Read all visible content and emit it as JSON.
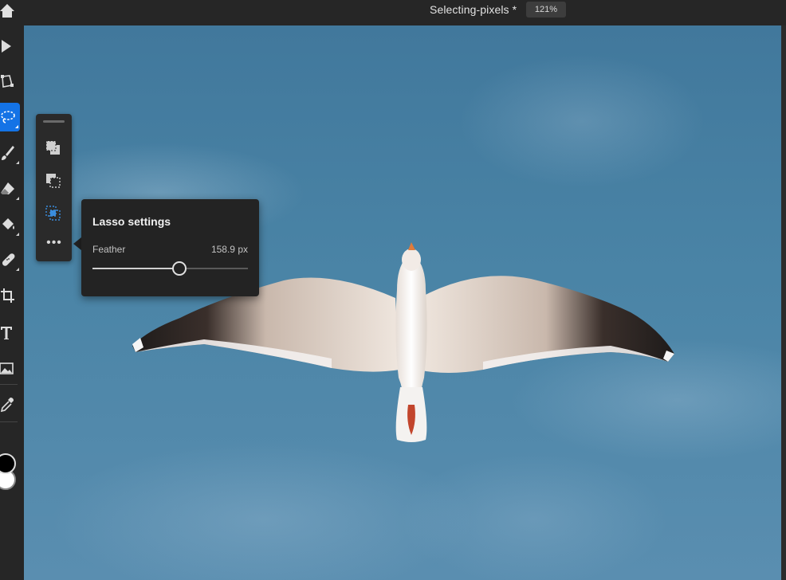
{
  "header": {
    "document_title": "Selecting-pixels *",
    "zoom_level": "121%"
  },
  "toolbar": {
    "tools": [
      {
        "name": "move-tool",
        "icon": "arrow-pointer-icon"
      },
      {
        "name": "transform-tool",
        "icon": "transform-icon"
      },
      {
        "name": "lasso-tool",
        "icon": "lasso-icon",
        "active": true
      },
      {
        "name": "brush-tool",
        "icon": "brush-icon"
      },
      {
        "name": "eraser-tool",
        "icon": "eraser-icon"
      },
      {
        "name": "fill-tool",
        "icon": "paint-bucket-icon"
      },
      {
        "name": "healing-tool",
        "icon": "bandage-icon"
      },
      {
        "name": "crop-tool",
        "icon": "crop-icon"
      },
      {
        "name": "type-tool",
        "icon": "type-icon"
      },
      {
        "name": "place-image-tool",
        "icon": "image-icon"
      },
      {
        "name": "eyedropper-tool",
        "icon": "eyedropper-icon"
      }
    ],
    "foreground_color": "#000000",
    "background_color": "#ffffff"
  },
  "selection_options": {
    "buttons": [
      "add-to-selection-icon",
      "subtract-from-selection-icon",
      "intersect-selection-icon"
    ],
    "more_label": "•••"
  },
  "lasso_settings": {
    "title": "Lasso settings",
    "feather_label": "Feather",
    "feather_value": "158.9 px",
    "feather_slider_fraction": 0.56
  },
  "colors": {
    "accent": "#1473e6",
    "panel": "#232323",
    "chrome": "#262626"
  }
}
